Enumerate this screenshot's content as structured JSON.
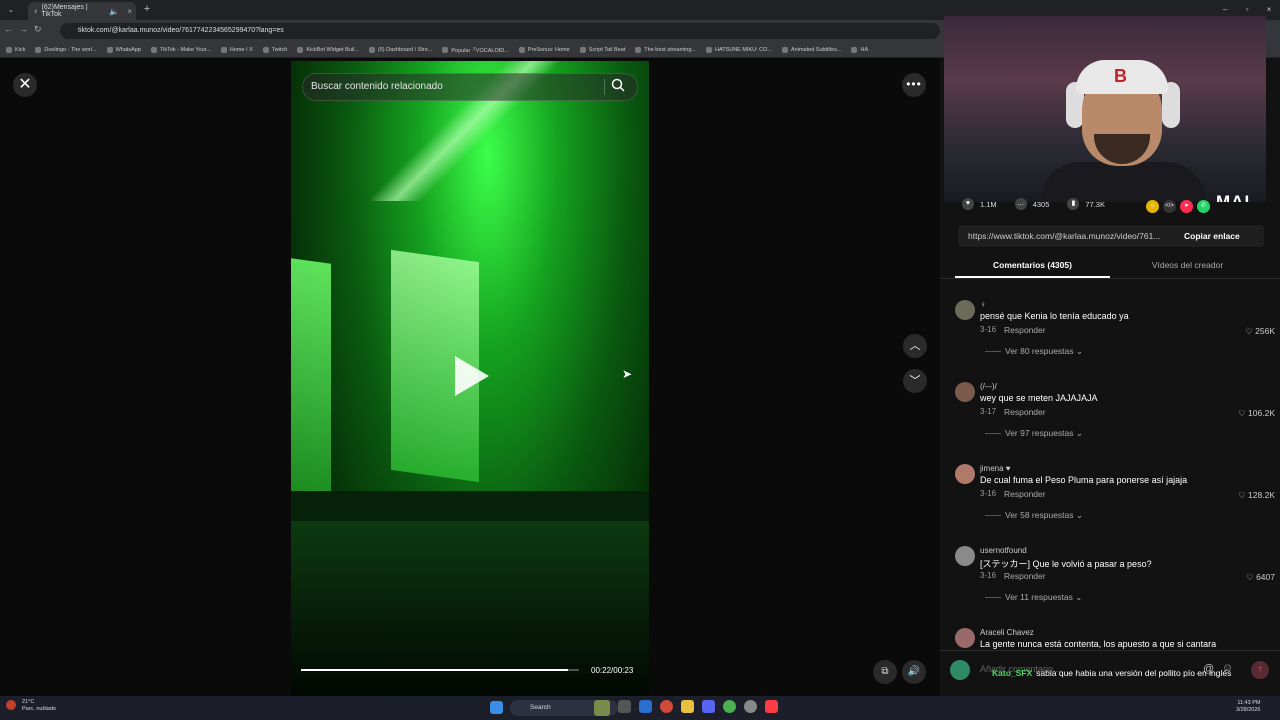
{
  "browser": {
    "tab_title": "(62)Mensajes | TikTok",
    "url": "tiktok.com/@karlaa.munoz/video/7617742234565299470?lang=es",
    "bookmarks": [
      "Kick",
      "Duolingo - The worl...",
      "WhatsApp",
      "TikTok - Make Your...",
      "Home / X",
      "Twitch",
      "KickBot Widget Buil...",
      "(5) Dashboard / Stre...",
      "Popular「VOCALOID...",
      "PreSonus: Home",
      "Script Tail Beat",
      "The best streaming...",
      "HATSUNE MIKU: CO...",
      "Animated Subtitles...",
      "HA"
    ]
  },
  "video": {
    "search_placeholder": "Buscar contenido relacionado",
    "time": "00:22/00:23",
    "progress": 0.96
  },
  "webcam": {
    "overlay_logo": "MAI",
    "cap_logo": "B"
  },
  "stats": {
    "likes": "1.1M",
    "comments": "4305",
    "saves": "77.3K"
  },
  "share": {
    "link": "https://www.tiktok.com/@karlaa.munoz/video/761...",
    "copy_label": "Copiar enlace"
  },
  "tabs": {
    "comments_label": "Comentarios (4305)",
    "creator_label": "Vídeos del creador"
  },
  "comments": [
    {
      "user": "♀",
      "text": "pensé que Kenia lo tenía educado ya",
      "date": "3-16",
      "reply": "Responder",
      "likes": "256K",
      "more": "Ver 80 respuestas",
      "avatar_color": "#6b6b5a"
    },
    {
      "user": "(/–-)/",
      "text": "wey que se meten JAJAJAJA",
      "date": "3-17",
      "reply": "Responder",
      "likes": "106.2K",
      "more": "Ver 97 respuestas",
      "avatar_color": "#7a5a4a"
    },
    {
      "user": "jimena ♥",
      "text": "De cual fuma el Peso Pluma para ponerse así jajaja",
      "date": "3-16",
      "reply": "Responder",
      "likes": "128.2K",
      "more": "Ver 58 respuestas",
      "avatar_color": "#b07a6a"
    },
    {
      "user": "usernotfound",
      "text": "[ステッカー] Que le volvió a pasar a peso?",
      "date": "3-16",
      "reply": "Responder",
      "likes": "6407",
      "more": "Ver 11 respuestas",
      "avatar_color": "#8a8a8a"
    },
    {
      "user": "Araceli Chavez",
      "text": "La gente nunca está contenta, los apuesto a que si cantara",
      "date": "",
      "reply": "",
      "likes": "",
      "more": "",
      "avatar_color": "#9a6a6a"
    }
  ],
  "comment_input": {
    "placeholder": "Añadir comentario..."
  },
  "chat": {
    "name": "Kato_SFX",
    "message": "sabia que habia una versión del pollito pío en inglés"
  },
  "taskbar": {
    "temp": "21°C",
    "weather": "Parc. nublado",
    "search": "Search",
    "time": "11:43 PM",
    "date": "3/28/2026"
  },
  "colors": {
    "accent": "#fe2c55",
    "chat_name": "#4cd964",
    "video_green": "#15a21f"
  }
}
